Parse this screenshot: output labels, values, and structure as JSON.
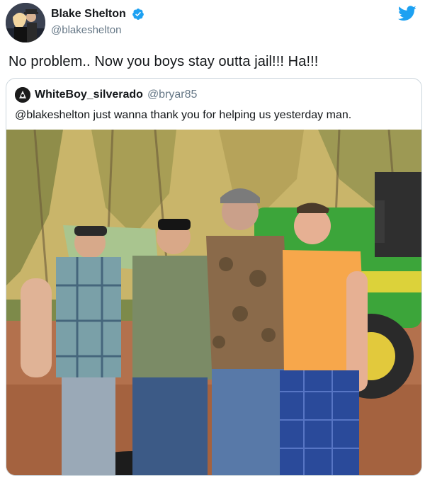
{
  "tweet": {
    "display_name": "Blake Shelton",
    "handle": "@blakeshelton",
    "verified": true,
    "text": "No problem.. Now you boys stay outta jail!!! Ha!!!",
    "icons": {
      "brand": "twitter-bird-icon",
      "verified": "verified-badge-icon"
    },
    "colors": {
      "brand": "#1da1f2",
      "text": "#14171a",
      "muted": "#657786",
      "border": "#ccd6dd"
    }
  },
  "quoted": {
    "display_name": "WhiteBoy_silverado",
    "handle": "@bryar85",
    "text": "@blakeshelton just wanna thank you for helping us yesterday man."
  }
}
